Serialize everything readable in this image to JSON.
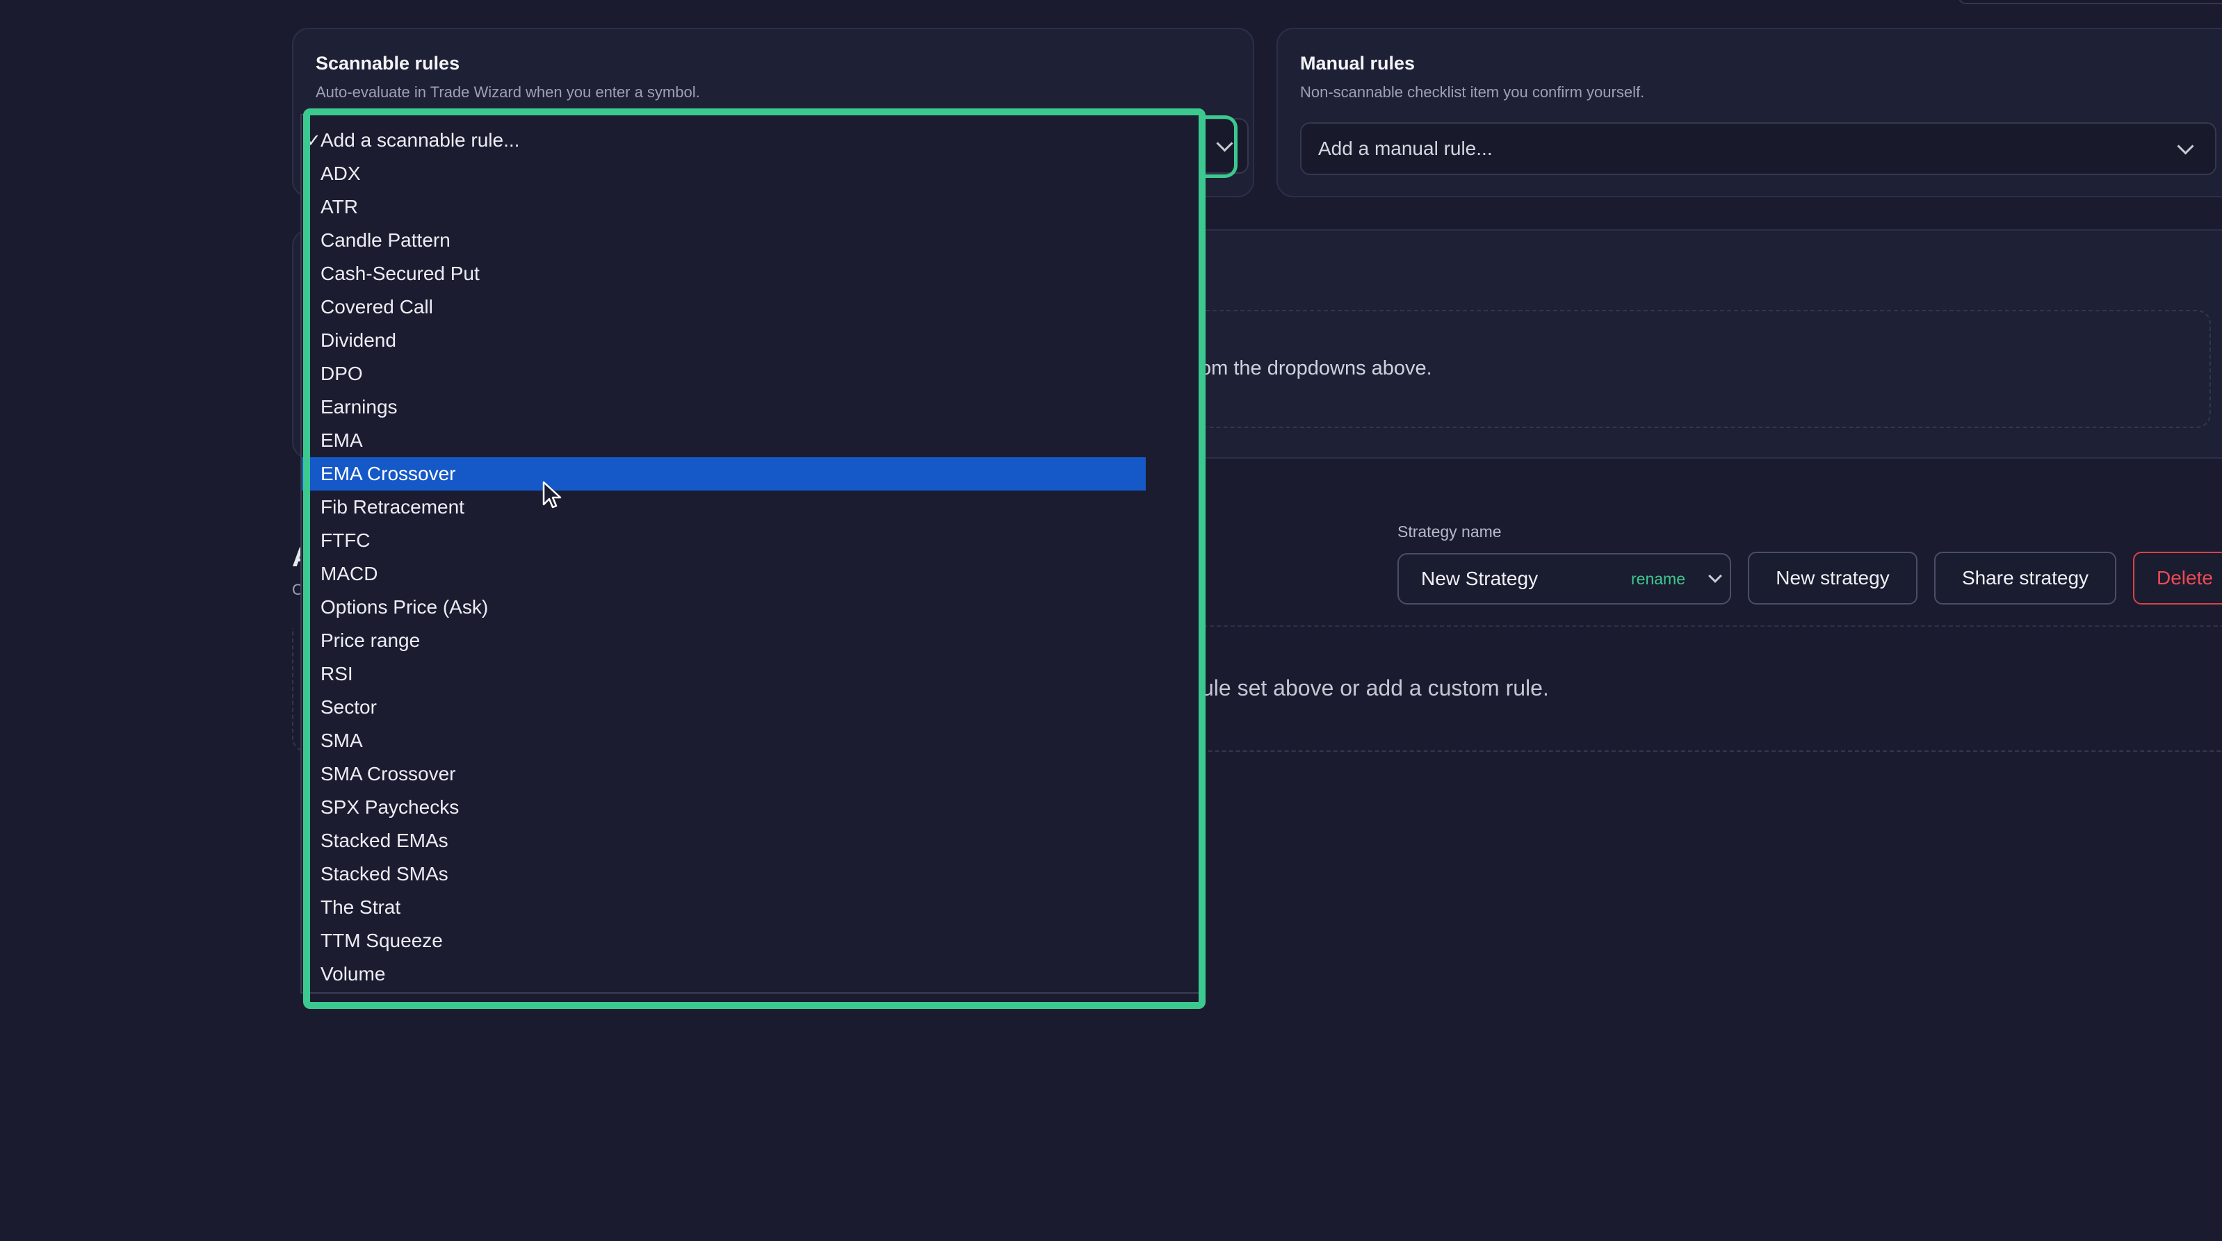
{
  "scannable": {
    "title": "Scannable rules",
    "subtitle": "Auto-evaluate in Trade Wizard when you enter a symbol."
  },
  "manual": {
    "title": "Manual rules",
    "subtitle": "Non-scannable checklist item you confirm yourself.",
    "select_value": "Add a manual rule..."
  },
  "rules_area": {
    "empty_text_visible": "om the dropdowns above."
  },
  "strategy": {
    "name_label": "Strategy name",
    "name_value": "New Strategy",
    "rename_label": "rename",
    "new_strategy_label": "New strategy",
    "share_strategy_label": "Share strategy",
    "delete_label": "Delete",
    "empty_text_visible": "ule set above or add a custom rule.",
    "partial_heading": "A",
    "partial_sub": "C"
  },
  "dropdown": {
    "selected_check": "✓",
    "options": [
      "Add a scannable rule...",
      "ADX",
      "ATR",
      "Candle Pattern",
      "Cash-Secured Put",
      "Covered Call",
      "Dividend",
      "DPO",
      "Earnings",
      "EMA",
      "EMA Crossover",
      "Fib Retracement",
      "FTFC",
      "MACD",
      "Options Price (Ask)",
      "Price range",
      "RSI",
      "Sector",
      "SMA",
      "SMA Crossover",
      "SPX Paychecks",
      "Stacked EMAs",
      "Stacked SMAs",
      "The Strat",
      "TTM Squeeze",
      "Volume"
    ],
    "highlighted_option": "EMA Crossover"
  },
  "colors": {
    "background": "#1a1b2e",
    "accent_green": "#3cc98f",
    "highlight_blue": "#1558c7",
    "danger_red": "#ef4a55"
  },
  "icons": {
    "dropdown_arrow": "chevron-down-icon",
    "cursor": "pointer-cursor-icon",
    "selected_mark": "check-icon"
  }
}
